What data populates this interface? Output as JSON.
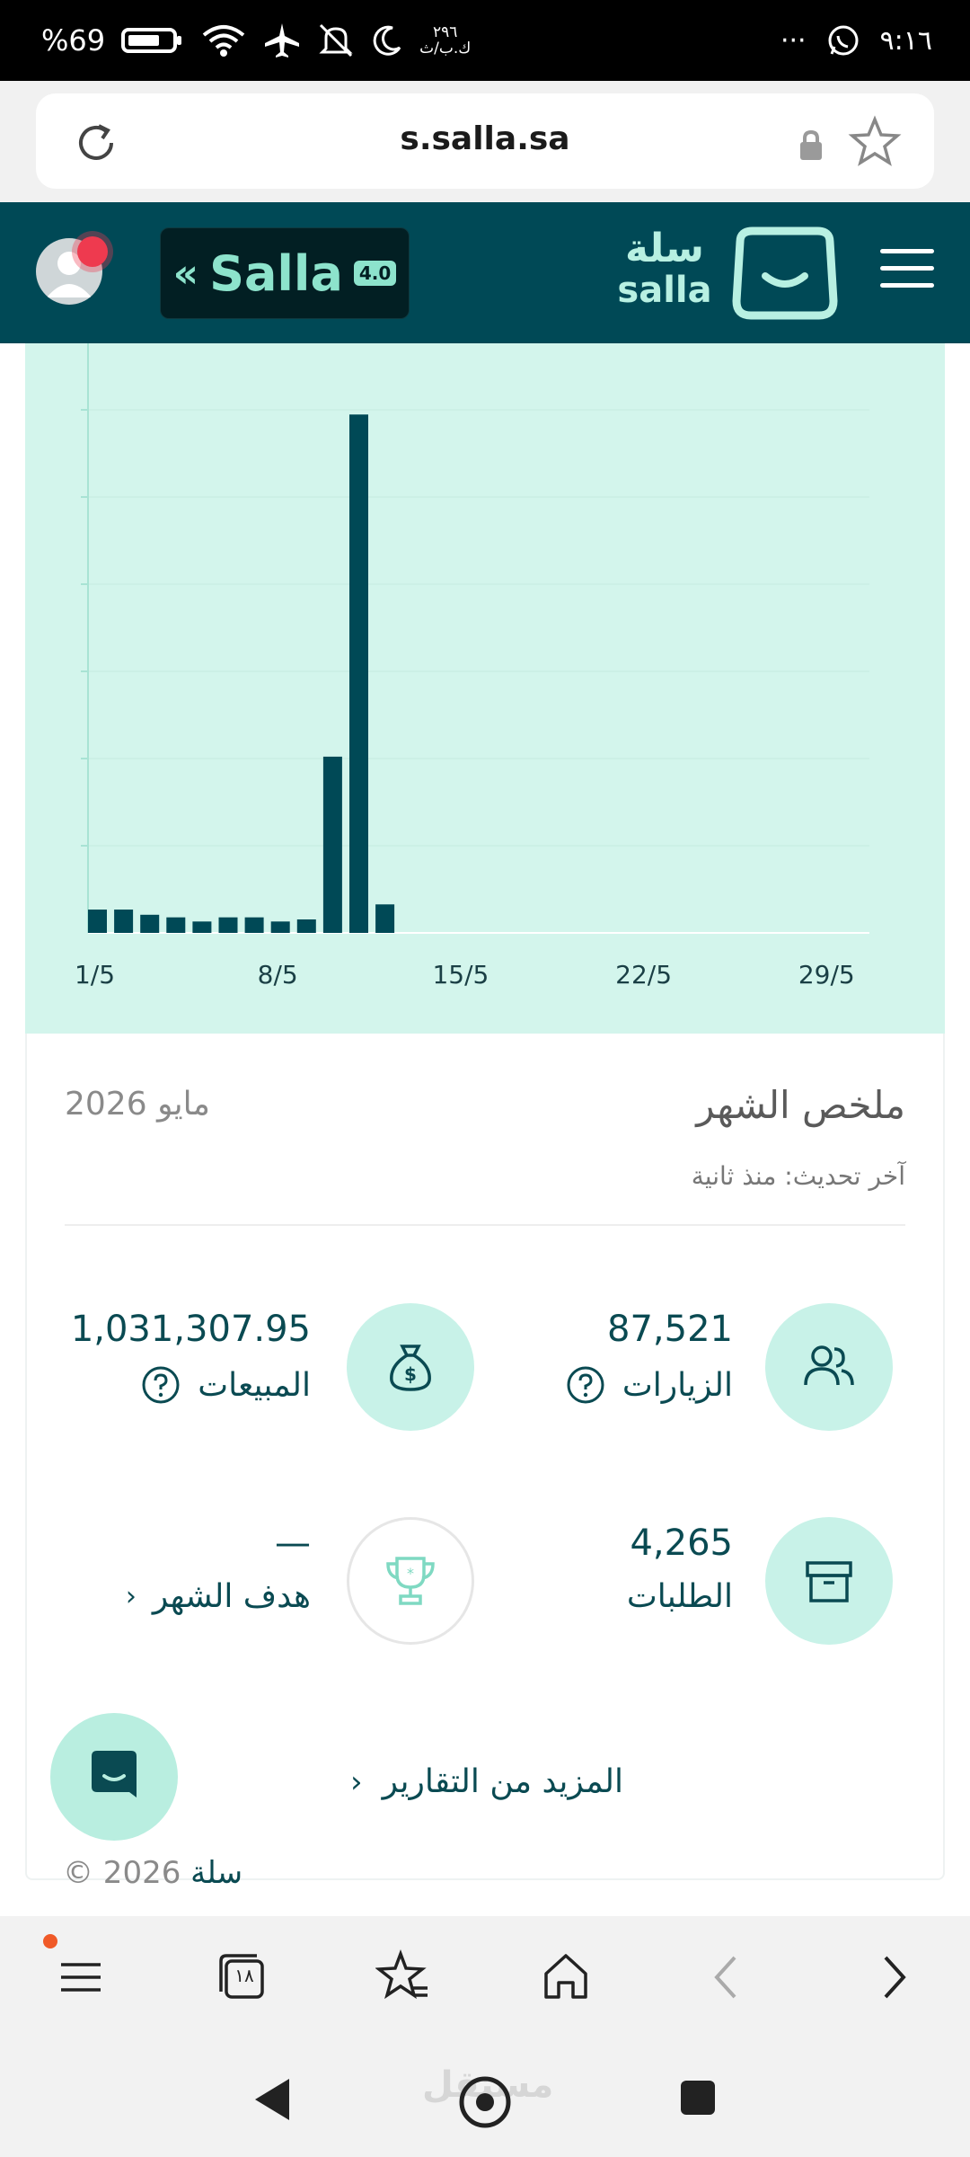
{
  "status_bar": {
    "time": "٩:١٦",
    "battery": "%69",
    "network_speed_top": "٢٩٦",
    "network_speed_unit": "ك.ب/ث",
    "more": "···"
  },
  "browser": {
    "url": "s.salla.sa",
    "tab_count": "١٨"
  },
  "header": {
    "badge_text": "Salla",
    "badge_version": "4.0",
    "logo_ar": "سلة",
    "logo_en": "salla"
  },
  "chart_data": {
    "type": "bar",
    "x_tick_labels": [
      "1/5",
      "8/5",
      "15/5",
      "22/5",
      "29/5"
    ],
    "categories": [
      "1/5",
      "2/5",
      "3/5",
      "4/5",
      "5/5",
      "6/5",
      "7/5",
      "8/5",
      "9/5",
      "10/5",
      "11/5",
      "12/5",
      "13/5",
      "14/5",
      "15/5",
      "16/5",
      "17/5",
      "18/5",
      "19/5",
      "20/5",
      "21/5",
      "22/5",
      "23/5",
      "24/5",
      "25/5",
      "26/5",
      "27/5",
      "28/5",
      "29/5",
      "30/5",
      "31/5"
    ],
    "values": [
      4.5,
      4.5,
      3.5,
      3,
      2.2,
      3,
      3,
      2.2,
      2.6,
      34,
      100,
      5.5,
      0,
      0,
      0,
      0,
      0,
      0,
      0,
      0,
      0,
      0,
      0,
      0,
      0,
      0,
      0,
      0,
      0,
      0,
      0
    ],
    "ylim": [
      0,
      112
    ],
    "grid": true,
    "bar_color": "#004956",
    "background": "#d3f5ec"
  },
  "summary": {
    "title": "ملخص الشهر",
    "month": "مايو 2026",
    "updated": "آخر تحديث: منذ ثانية"
  },
  "stats": {
    "visits": {
      "value": "87,521",
      "label": "الزيارات",
      "icon": "users-icon"
    },
    "sales": {
      "value": "1,031,307.95",
      "label": "المبيعات",
      "icon": "money-bag-icon"
    },
    "orders": {
      "value": "4,265",
      "label": "الطلبات",
      "icon": "box-icon"
    },
    "goal": {
      "value": "—",
      "label": "هدف الشهر",
      "icon": "trophy-icon"
    }
  },
  "more_reports": "المزيد من التقارير",
  "footer": {
    "brand": "سلة",
    "copyright": "© 2026"
  },
  "watermark": "مستقل",
  "colors": {
    "brand_dark": "#004956",
    "brand_mint": "#b8f0e2",
    "accent_light": "#c8f2e8"
  }
}
